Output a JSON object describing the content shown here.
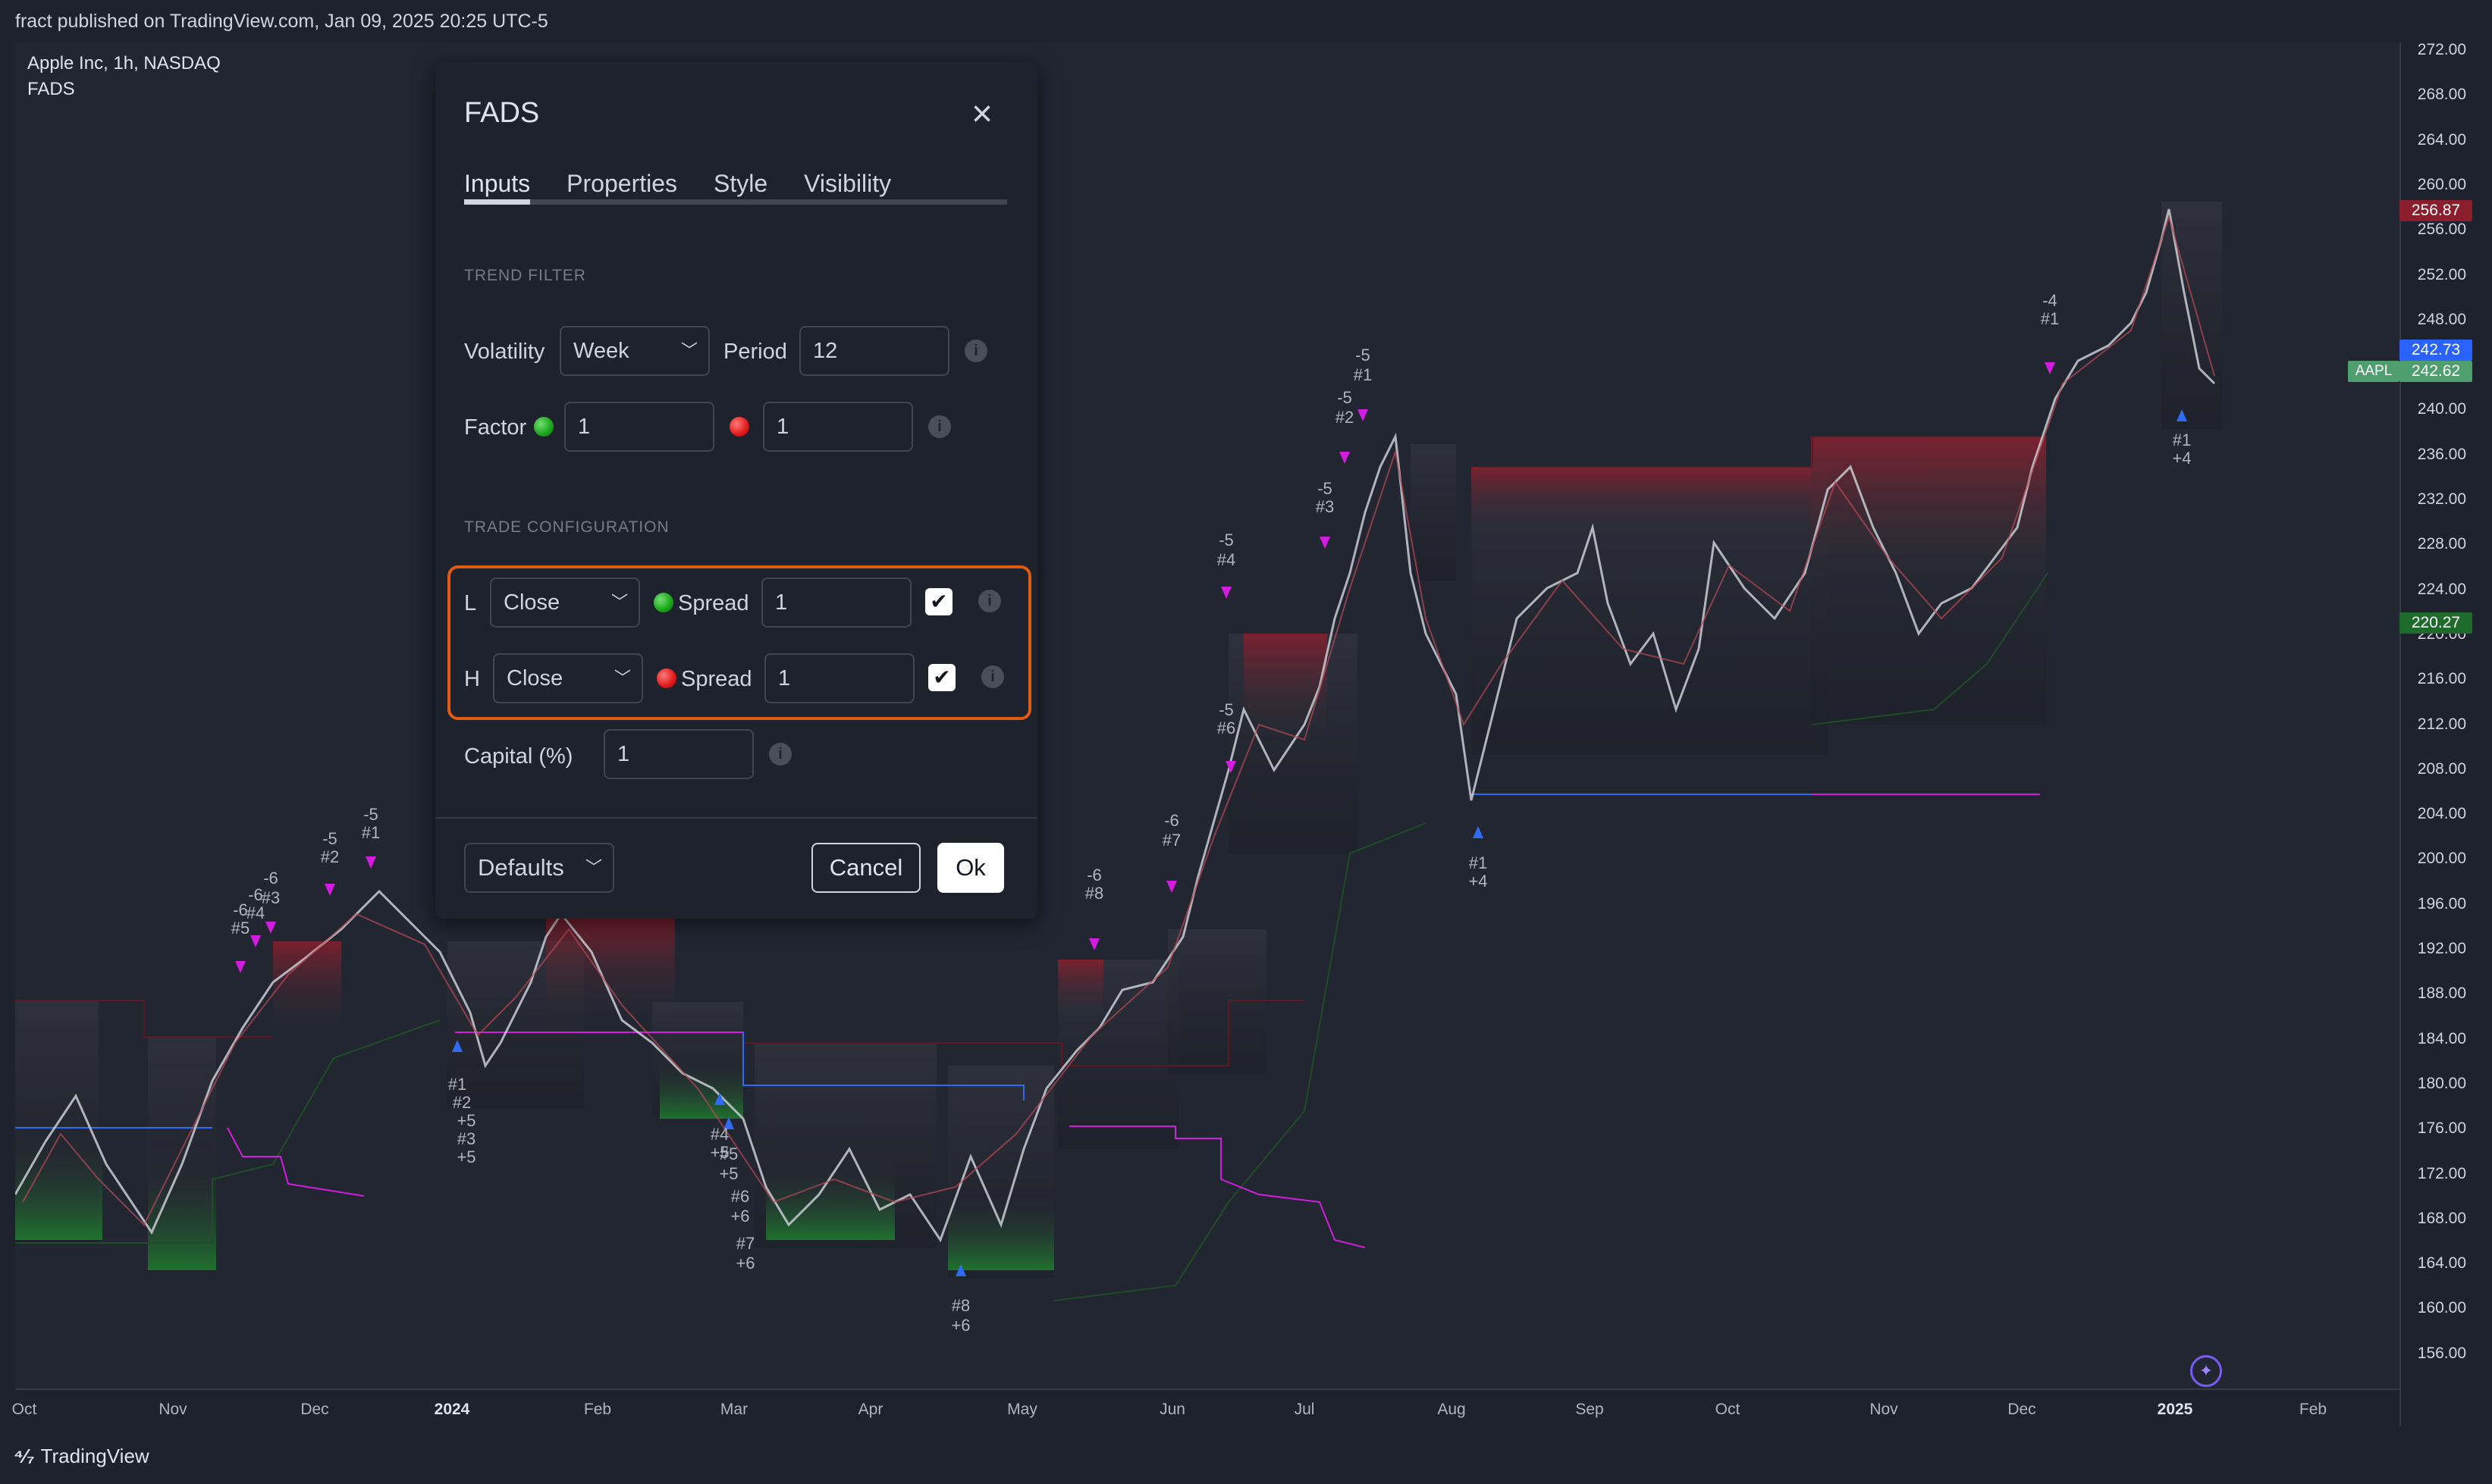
{
  "header": {
    "published": "fract published on TradingView.com, Jan 09, 2025 20:25 UTC-5"
  },
  "legend": {
    "symbol": "Apple Inc, 1h, NASDAQ",
    "indicator": "FADS"
  },
  "price_axis": {
    "ticks": [
      "272.00",
      "268.00",
      "264.00",
      "260.00",
      "256.00",
      "252.00",
      "248.00",
      "244.00",
      "240.00",
      "236.00",
      "232.00",
      "228.00",
      "224.00",
      "220.00",
      "216.00",
      "212.00",
      "208.00",
      "204.00",
      "200.00",
      "196.00",
      "192.00",
      "188.00",
      "184.00",
      "180.00",
      "176.00",
      "172.00",
      "168.00",
      "164.00",
      "160.00",
      "156.00"
    ],
    "badges": {
      "upper_red": "256.87",
      "blue": "242.73",
      "last": "242.62",
      "lower_green": "220.27"
    },
    "symbol_tag": "AAPL"
  },
  "time_axis": {
    "ticks": [
      {
        "label": "Oct",
        "bold": false
      },
      {
        "label": "Nov",
        "bold": false
      },
      {
        "label": "Dec",
        "bold": false
      },
      {
        "label": "2024",
        "bold": true
      },
      {
        "label": "Feb",
        "bold": false
      },
      {
        "label": "Mar",
        "bold": false
      },
      {
        "label": "Apr",
        "bold": false
      },
      {
        "label": "May",
        "bold": false
      },
      {
        "label": "Jun",
        "bold": false
      },
      {
        "label": "Jul",
        "bold": false
      },
      {
        "label": "Aug",
        "bold": false
      },
      {
        "label": "Sep",
        "bold": false
      },
      {
        "label": "Oct",
        "bold": false
      },
      {
        "label": "Nov",
        "bold": false
      },
      {
        "label": "Dec",
        "bold": false
      },
      {
        "label": "2025",
        "bold": true
      },
      {
        "label": "Feb",
        "bold": false
      }
    ]
  },
  "chart_annotations": {
    "sell_labels": [
      "-6\n#5",
      "-6\n#4",
      "-6\n#3",
      "-5\n#2",
      "-5\n#1",
      "-6\n#8",
      "-6\n#7",
      "-5\n#4",
      "-5\n#6",
      "-5\n#3",
      "-5\n#2",
      "-5\n#1",
      "-4\n#1"
    ],
    "buy_labels": [
      "#1\n+5",
      "#2",
      "#3\n+5",
      "#4\n+5",
      "#5\n+5",
      "#6\n+6",
      "#7\n+6",
      "#8\n+6",
      "#1\n+4",
      "#1\n+4"
    ]
  },
  "dialog": {
    "title": "FADS",
    "tabs": [
      "Inputs",
      "Properties",
      "Style",
      "Visibility"
    ],
    "active_tab": "Inputs",
    "trend_filter": {
      "section": "TREND FILTER",
      "volatility_label": "Volatility",
      "volatility_value": "Week",
      "period_label": "Period",
      "period_value": "12",
      "factor_label": "Factor",
      "factor_green_value": "1",
      "factor_red_value": "1"
    },
    "trade_config": {
      "section": "TRADE CONFIGURATION",
      "rows": [
        {
          "label": "L",
          "source": "Close",
          "spread_label": "Spread",
          "spread_value": "1",
          "checked": true,
          "dot": "green"
        },
        {
          "label": "H",
          "source": "Close",
          "spread_label": "Spread",
          "spread_value": "1",
          "checked": true,
          "dot": "red"
        }
      ],
      "capital_label": "Capital (%)",
      "capital_value": "1"
    },
    "footer": {
      "defaults": "Defaults",
      "cancel": "Cancel",
      "ok": "Ok"
    }
  },
  "branding": {
    "logo_text": "TradingView"
  },
  "colors": {
    "background": "#1e222d",
    "candle_up": "#e0e3eb",
    "candle_down": "#b84a55",
    "zone_red": "#7a1f2b",
    "zone_green": "#1f6b2c",
    "signal_magenta": "#d21de0",
    "signal_blue": "#2f6cf5",
    "accent_orange": "#e05a12"
  }
}
